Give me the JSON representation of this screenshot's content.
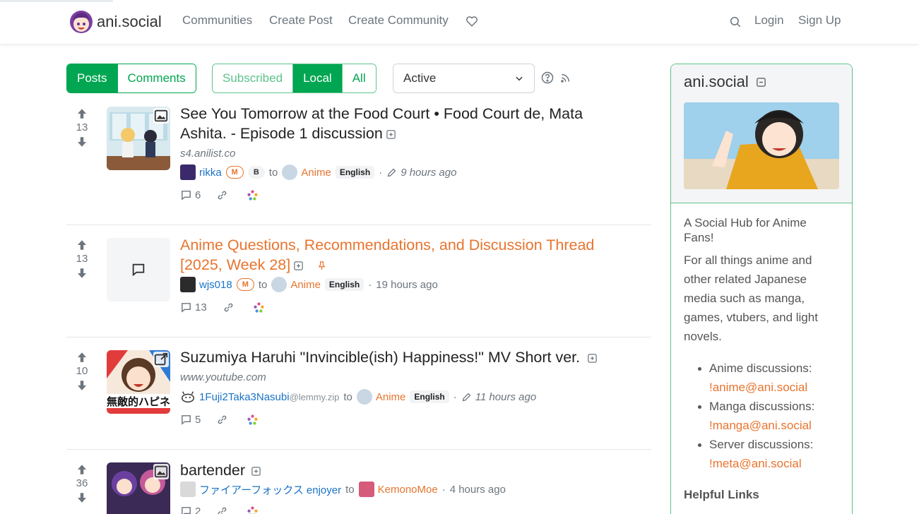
{
  "colors": {
    "accent": "#00a651",
    "orange": "#e8742e",
    "link": "#1a73c6",
    "muted": "#6c757d"
  },
  "navbar": {
    "brand": "ani.social",
    "links": [
      "Communities",
      "Create Post",
      "Create Community"
    ],
    "donate_icon": "heart-icon",
    "search_icon": "search-icon",
    "login": "Login",
    "signup": "Sign Up"
  },
  "filters": {
    "type_tabs": [
      {
        "label": "Posts",
        "active": true
      },
      {
        "label": "Comments",
        "active": false
      }
    ],
    "listing_tabs": [
      {
        "label": "Subscribed",
        "active": false
      },
      {
        "label": "Local",
        "active": true
      },
      {
        "label": "All",
        "active": false
      }
    ],
    "sort_selected": "Active",
    "help_icon": "question-circle-icon",
    "rss_icon": "rss-icon"
  },
  "posts": [
    {
      "score": "13",
      "title": "See You Tomorrow at the Food Court • Food Court de, Mata Ashita. - Episode 1 discussion",
      "domain": "s4.anilist.co",
      "author": "rikka",
      "badges": [
        "M",
        "B"
      ],
      "to": "to",
      "community": "Anime",
      "language": "English",
      "time": "9 hours ago",
      "comments": "6"
    },
    {
      "score": "13",
      "title": "Anime Questions, Recommendations, and Discussion Thread [2025, Week 28]",
      "author": "wjs018",
      "badges": [
        "M"
      ],
      "to": "to",
      "community": "Anime",
      "language": "English",
      "time": "19 hours ago",
      "comments": "13"
    },
    {
      "score": "10",
      "title": "Suzumiya Haruhi \"Invincible(ish) Happiness!\" MV Short ver.",
      "domain": "www.youtube.com",
      "author": "1Fuji2Taka3Nasubi",
      "author_instance": "@lemmy.zip",
      "to": "to",
      "community": "Anime",
      "language": "English",
      "time": "11 hours ago",
      "comments": "5",
      "thumb_text": "無敵的ハピネ"
    },
    {
      "score": "36",
      "title": "bartender",
      "author": "ファイアーフォックス enjoyer",
      "to": "to",
      "community": "KemonoMoe",
      "time": "4 hours ago",
      "comments": "2"
    }
  ],
  "sidebar": {
    "title": "ani.social",
    "tagline": "A Social Hub for Anime Fans!",
    "description": "For all things anime and other related Japanese media such as manga, games, vtubers, and light novels.",
    "links": [
      {
        "label": "Anime discussions: ",
        "link": "!anime@ani.social"
      },
      {
        "label": "Manga discussions: ",
        "link": "!manga@ani.social"
      },
      {
        "label": "Server discussions: ",
        "link": "!meta@ani.social"
      }
    ],
    "heading": "Helpful Links"
  }
}
